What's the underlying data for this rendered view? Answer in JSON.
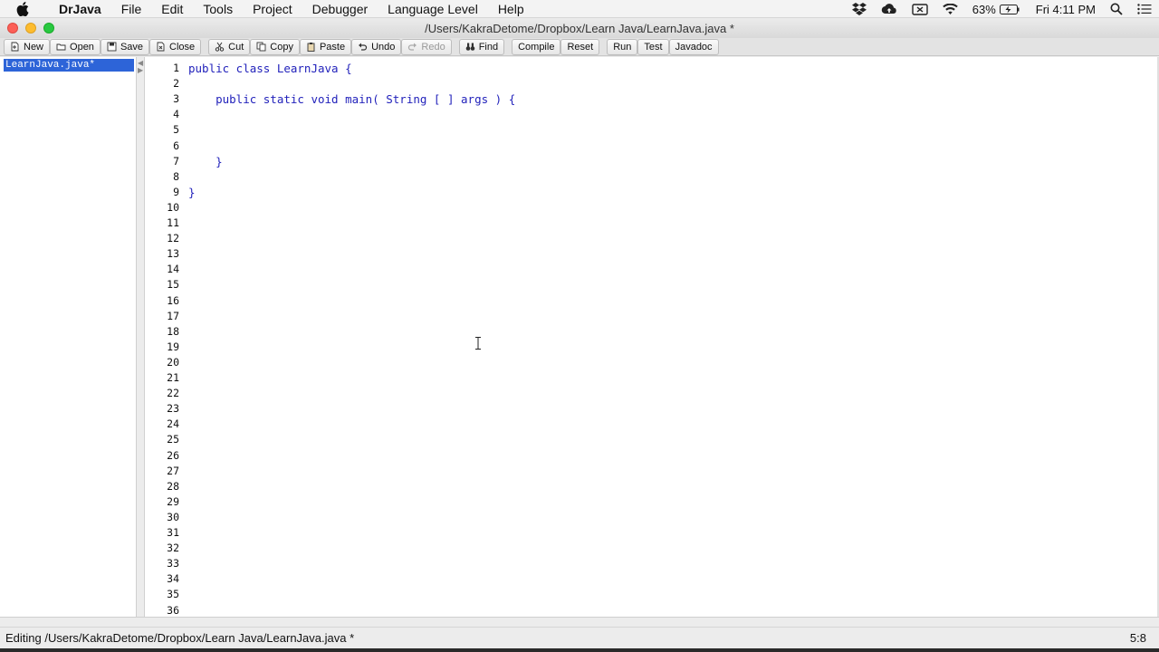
{
  "menubar": {
    "app_name": "DrJava",
    "items": [
      "File",
      "Edit",
      "Tools",
      "Project",
      "Debugger",
      "Language Level",
      "Help"
    ],
    "battery": "63%",
    "clock": "Fri 4:11 PM"
  },
  "window": {
    "title": "/Users/KakraDetome/Dropbox/Learn Java/LearnJava.java *"
  },
  "toolbar": {
    "new": "New",
    "open": "Open",
    "save": "Save",
    "close": "Close",
    "cut": "Cut",
    "copy": "Copy",
    "paste": "Paste",
    "undo": "Undo",
    "redo": "Redo",
    "find": "Find",
    "compile": "Compile",
    "reset": "Reset",
    "run": "Run",
    "test": "Test",
    "javadoc": "Javadoc"
  },
  "documents": [
    "LearnJava.java*"
  ],
  "editor": {
    "lines": [
      "public class LearnJava {",
      "",
      "    public static void main( String [ ] args ) {",
      "",
      "",
      "",
      "    }",
      "",
      "}",
      "",
      "",
      "",
      "",
      "",
      "",
      "",
      "",
      "",
      "",
      "",
      "",
      "",
      "",
      "",
      "",
      "",
      "",
      "",
      "",
      "",
      "",
      "",
      "",
      "",
      "",
      ""
    ]
  },
  "status": {
    "message": "Editing /Users/KakraDetome/Dropbox/Learn Java/LearnJava.java *",
    "position": "5:8"
  },
  "colors": {
    "keyword": "#2222bb",
    "selection": "#2d64d8"
  }
}
